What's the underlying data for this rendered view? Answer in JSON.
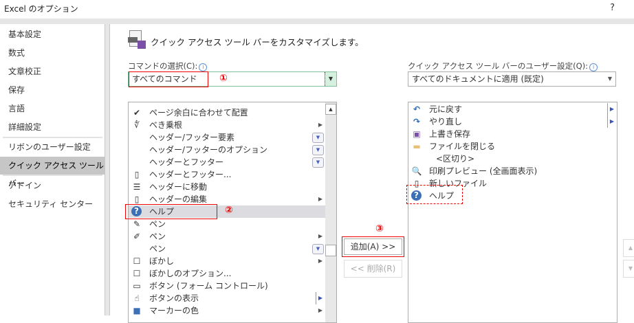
{
  "window": {
    "title": "Excel のオプション",
    "help": "?"
  },
  "sidebar": {
    "items": [
      {
        "label": "基本設定"
      },
      {
        "label": "数式"
      },
      {
        "label": "文章校正"
      },
      {
        "label": "保存"
      },
      {
        "label": "言語"
      },
      {
        "label": "詳細設定"
      },
      {
        "label": "リボンのユーザー設定"
      },
      {
        "label": "クイック アクセス ツール バー",
        "selected": true
      },
      {
        "label": "アドイン"
      },
      {
        "label": "セキュリティ センター"
      }
    ]
  },
  "main": {
    "heading": "クイック アクセス ツール バーをカスタマイズします。",
    "choose_label": "コマンドの選択(C):",
    "choose_value": "すべてのコマンド",
    "custom_label": "クイック アクセス ツール バーのユーザー設定(Q):",
    "custom_value": "すべてのドキュメントに適用 (既定)",
    "commands": [
      {
        "label": "ページ余白に合わせて配置",
        "icon": "check-icon"
      },
      {
        "label": "べき乗根",
        "icon": "radical-icon",
        "sub": "arrow"
      },
      {
        "label": "ヘッダー/フッター要素",
        "sub": "dropdown"
      },
      {
        "label": "ヘッダー/フッターのオプション",
        "sub": "dropdown"
      },
      {
        "label": "ヘッダーとフッター",
        "sub": "dropdown"
      },
      {
        "label": "ヘッダーとフッター...",
        "icon": "page-icon"
      },
      {
        "label": "ヘッダーに移動",
        "icon": "page-lines-icon"
      },
      {
        "label": "ヘッダーの編集",
        "icon": "page-icon",
        "sub": "arrow"
      },
      {
        "label": "ヘルプ",
        "icon": "help-icon",
        "selected": true
      },
      {
        "label": "ペン",
        "icon": "pen-icon"
      },
      {
        "label": "ペン",
        "icon": "pens-icon",
        "sub": "arrow"
      },
      {
        "label": "ペン",
        "sub": "dropdown"
      },
      {
        "label": "ぼかし",
        "icon": "checkbox-icon",
        "sub": "arrow"
      },
      {
        "label": "ぼかしのオプション...",
        "icon": "checkbox-icon"
      },
      {
        "label": "ボタン (フォーム コントロール)",
        "icon": "button-icon"
      },
      {
        "label": "ボタンの表示",
        "icon": "touch-icon",
        "sub": "split"
      },
      {
        "label": "マーカーの色",
        "icon": "color-icon",
        "sub": "arrow"
      }
    ],
    "toolbar_items": [
      {
        "label": "元に戻す",
        "icon": "undo-icon",
        "sub": "split"
      },
      {
        "label": "やり直し",
        "icon": "redo-icon",
        "sub": "split"
      },
      {
        "label": "上書き保存",
        "icon": "save-icon"
      },
      {
        "label": "ファイルを閉じる",
        "icon": "folder-icon"
      },
      {
        "label": "<区切り>",
        "icon": ""
      },
      {
        "label": "印刷プレビュー (全画面表示)",
        "icon": "print-preview-icon"
      },
      {
        "label": "新しいファイル",
        "icon": "new-file-icon"
      },
      {
        "label": "ヘルプ",
        "icon": "help-icon"
      }
    ],
    "add_button": "追加(A) >>",
    "remove_button": "<< 削除(R)",
    "annotations": [
      "①",
      "②",
      "③"
    ]
  },
  "colors": {
    "annotation": "#e00000",
    "selected": "#dcdce0",
    "sidebar_selected": "#c6c6c6"
  }
}
